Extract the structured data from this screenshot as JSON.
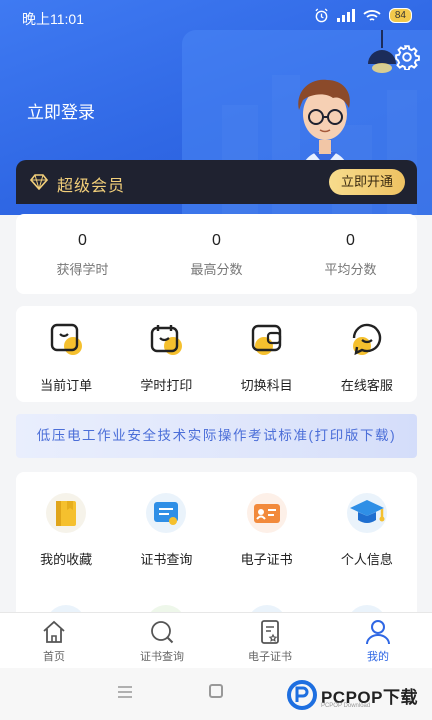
{
  "status_bar": {
    "time": "晚上11:01",
    "battery": "84"
  },
  "header": {
    "login_label": "立即登录"
  },
  "vip": {
    "label": "超级会员",
    "button": "立即开通"
  },
  "stats": [
    {
      "value": "0",
      "label": "获得学时"
    },
    {
      "value": "0",
      "label": "最高分数"
    },
    {
      "value": "0",
      "label": "平均分数"
    }
  ],
  "quick_actions": [
    {
      "label": "当前订单",
      "icon": "order-icon"
    },
    {
      "label": "学时打印",
      "icon": "print-icon"
    },
    {
      "label": "切换科目",
      "icon": "switch-subject-icon"
    },
    {
      "label": "在线客服",
      "icon": "customer-service-icon"
    }
  ],
  "banner": {
    "text": "低压电工作业安全技术实际操作考试标准(打印版下载)"
  },
  "services": [
    {
      "label": "我的收藏",
      "icon": "favorites-icon"
    },
    {
      "label": "证书查询",
      "icon": "certificate-query-icon"
    },
    {
      "label": "电子证书",
      "icon": "e-certificate-icon"
    },
    {
      "label": "个人信息",
      "icon": "personal-info-icon"
    }
  ],
  "tabbar": [
    {
      "label": "首页",
      "icon": "home-icon",
      "active": false
    },
    {
      "label": "证书查询",
      "icon": "search-icon",
      "active": false
    },
    {
      "label": "电子证书",
      "icon": "certificate-icon",
      "active": false
    },
    {
      "label": "我的",
      "icon": "user-icon",
      "active": true
    }
  ],
  "watermark": {
    "text": "PCPOP下载",
    "sub": "PCPOP Download"
  },
  "colors": {
    "primary": "#2f67e4",
    "accent_yellow": "#f5c02e",
    "vip_gold": "#f2cf7a",
    "vip_bg": "#1f2230"
  }
}
